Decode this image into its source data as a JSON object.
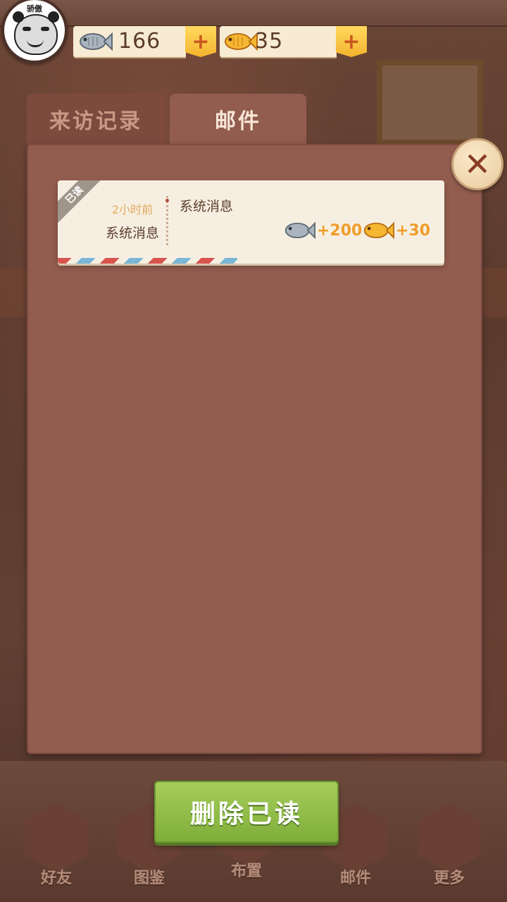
{
  "profile": {
    "name": "骄傲"
  },
  "currency": {
    "silver_fish": "166",
    "gold_fish": "35",
    "plus_label": "+"
  },
  "tabs": [
    {
      "label": "来访记录",
      "active": false
    },
    {
      "label": "邮件",
      "active": true
    }
  ],
  "close_label": "✕",
  "mails": [
    {
      "status": "已读",
      "time": "2小时前",
      "sender": "系统消息",
      "subject": "系统消息",
      "rewards": [
        {
          "icon": "silver-fish-icon",
          "amount": "+200"
        },
        {
          "icon": "gold-fish-icon",
          "amount": "+30"
        }
      ]
    }
  ],
  "delete_read_label": "删除已读",
  "nav": [
    {
      "label": "好友",
      "icon": "friends-icon"
    },
    {
      "label": "图鉴",
      "icon": "catalog-icon"
    },
    {
      "label": "布置",
      "icon": "decorate-icon"
    },
    {
      "label": "邮件",
      "icon": "mail-icon"
    },
    {
      "label": "更多",
      "icon": "more-icon"
    }
  ],
  "colors": {
    "panel": "#925c4f",
    "tab_inactive": "#7e4a3e",
    "button_green": "#8cbc45",
    "reward_orange": "#ef9d2b"
  }
}
